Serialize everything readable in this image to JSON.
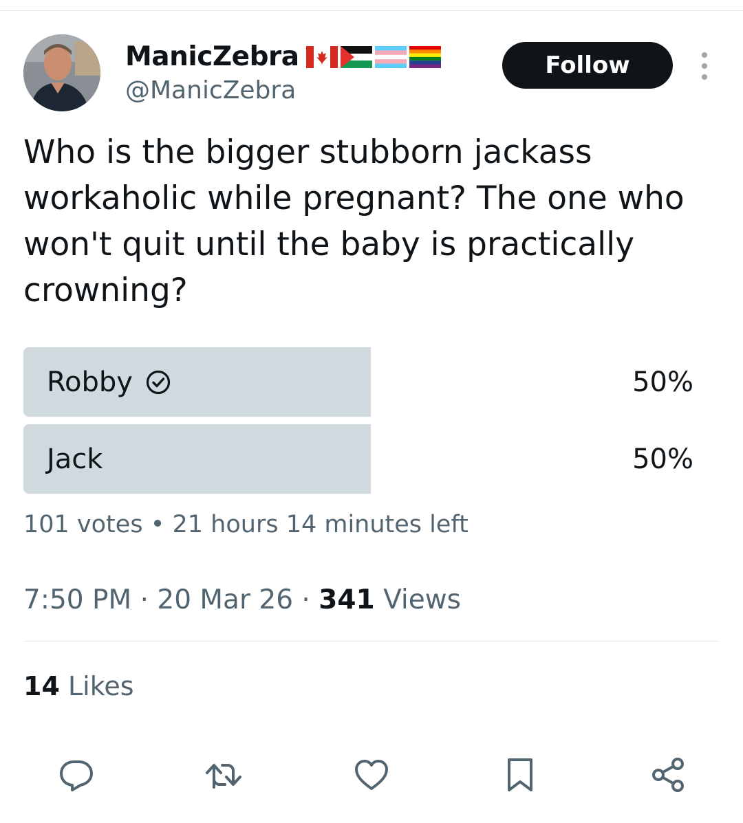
{
  "author": {
    "display_name": "ManicZebra",
    "handle": "@ManicZebra",
    "avatar_icon": "profile-photo",
    "flags": [
      "canada-flag",
      "palestine-flag",
      "transgender-flag",
      "pride-flag"
    ]
  },
  "header": {
    "follow_label": "Follow",
    "more_icon": "more-vertical-icon"
  },
  "tweet": {
    "text": "Who is the bigger stubborn jackass workaholic while pregnant? The one who won't quit until the baby is practically crowning?"
  },
  "poll": {
    "options": [
      {
        "label": "Robby",
        "percent": "50%",
        "fill": 0.5,
        "selected": true
      },
      {
        "label": "Jack",
        "percent": "50%",
        "fill": 0.5,
        "selected": false
      }
    ],
    "votes": "101 votes",
    "separator": "•",
    "time_left": "21 hours 14 minutes left"
  },
  "meta": {
    "time": "7:50 PM",
    "sep": "·",
    "date": "20 Mar 26",
    "views_count": "341",
    "views_label": "Views"
  },
  "stats": {
    "likes_count": "14",
    "likes_label": "Likes"
  },
  "actions": [
    "reply-icon",
    "retweet-icon",
    "like-icon",
    "bookmark-icon",
    "share-icon"
  ],
  "colors": {
    "text_primary": "#0f1419",
    "text_secondary": "#536471",
    "poll_fill": "#cfd9de",
    "follow_bg": "#0f1419",
    "divider": "#e4e7ea"
  }
}
